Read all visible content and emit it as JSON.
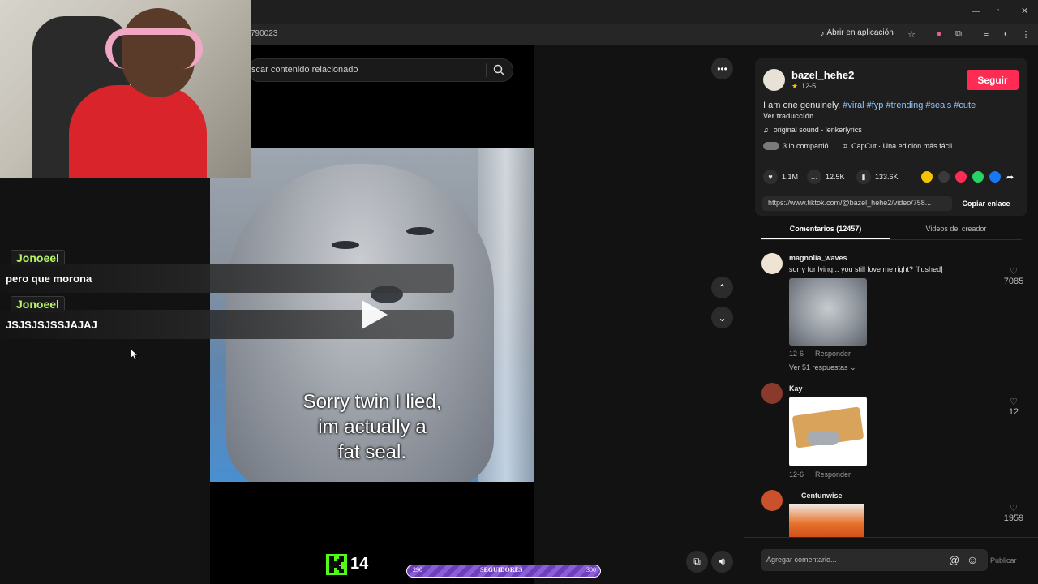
{
  "browser": {
    "url_fragment": "790023",
    "open_in_app": "Abrir en aplicación"
  },
  "search": {
    "placeholder": "scar contenido relacionado"
  },
  "video": {
    "caption_lines": [
      "Sorry twin I lied,",
      "im actually a",
      "fat seal."
    ]
  },
  "chat": [
    {
      "user": "Jonoeel",
      "message": "pero que morona"
    },
    {
      "user": "Jonoeel",
      "message": "JSJSJSJSSJAJAJ"
    }
  ],
  "kick": {
    "count": "14"
  },
  "followers_bar": {
    "min": "290",
    "label": "SEGUIDORES",
    "max": "300"
  },
  "author": {
    "username": "bazel_hehe2",
    "date": "12-5",
    "follow_label": "Seguir",
    "description": "I am one genuinely.",
    "hashtags": [
      "#viral",
      "#fyp",
      "#trending",
      "#seals",
      "#cute"
    ],
    "translate": "Ver traducción",
    "sound": "original sound - lenkerlyrics",
    "shared": "3 lo compartió",
    "capcut": "CapCut · Una edición más fácil"
  },
  "stats": {
    "likes": "1.1M",
    "comments": "12.5K",
    "saves": "133.6K"
  },
  "share_colors": [
    "#f5c400",
    "#3a3a3a",
    "#fe2c55",
    "#25d366",
    "#1877f2"
  ],
  "link": {
    "url": "https://www.tiktok.com/@bazel_hehe2/video/758...",
    "copy_label": "Copiar enlace"
  },
  "tabs": {
    "comments": "Comentarios (12457)",
    "creator_videos": "Videos del creador"
  },
  "comments": [
    {
      "user": "magnolia_waves",
      "text": "sorry for lying... you still love me right? [flushed]",
      "date": "12-6",
      "reply": "Responder",
      "likes": "7085",
      "replies": "Ver 51 respuestas"
    },
    {
      "user": "Kay",
      "date": "12-6",
      "reply": "Responder",
      "likes": "12"
    },
    {
      "user": "Centunwise",
      "likes": "1959"
    }
  ],
  "comment_box": {
    "placeholder": "Agregar comentario...",
    "post_label": "Publicar"
  }
}
